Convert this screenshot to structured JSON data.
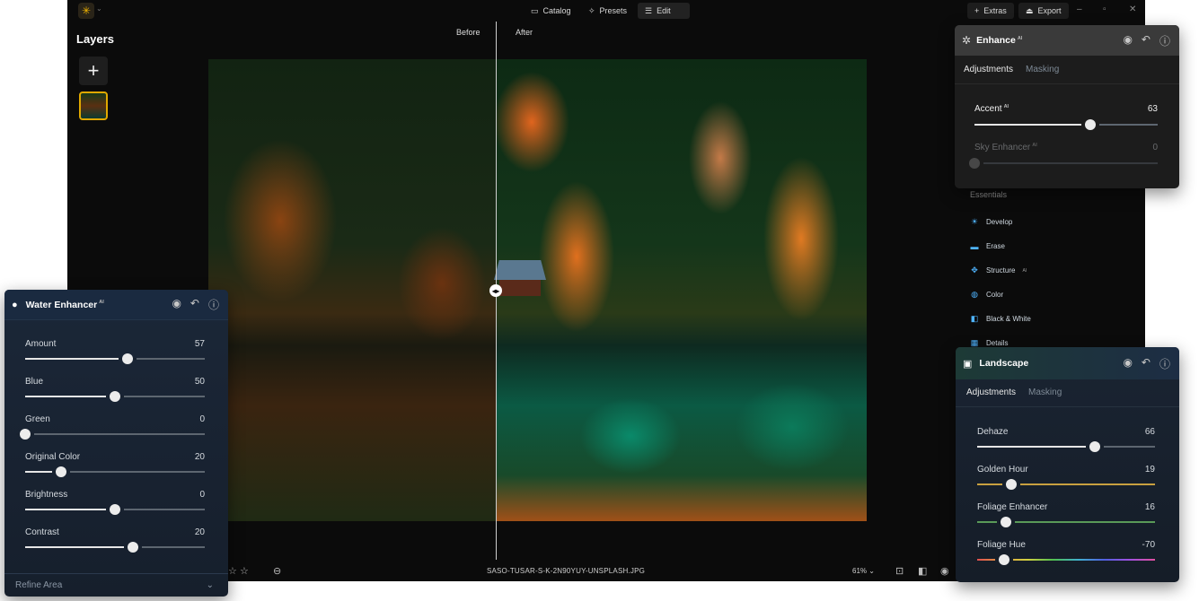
{
  "topbar": {
    "catalog": "Catalog",
    "presets": "Presets",
    "edit": "Edit",
    "extras": "Extras",
    "export": "Export"
  },
  "layers": {
    "title": "Layers"
  },
  "compare": {
    "before": "Before",
    "after": "After"
  },
  "enhance": {
    "title": "Enhance",
    "ai_badge": "AI",
    "tabs": [
      "Adjustments",
      "Masking"
    ],
    "sliders": [
      {
        "label": "Accent",
        "ai": "AI",
        "value": "63",
        "level": 0.63,
        "enabled": true
      },
      {
        "label": "Sky Enhancer",
        "ai": "AI",
        "value": "0",
        "level": 0,
        "enabled": false
      }
    ]
  },
  "essentials": {
    "heading": "Essentials",
    "items": [
      {
        "label": "Develop",
        "ai": ""
      },
      {
        "label": "Erase",
        "ai": ""
      },
      {
        "label": "Structure",
        "ai": "AI"
      },
      {
        "label": "Color",
        "ai": ""
      },
      {
        "label": "Black & White",
        "ai": ""
      },
      {
        "label": "Details",
        "ai": ""
      }
    ]
  },
  "water": {
    "title": "Water Enhancer",
    "ai_badge": "AI",
    "sliders": [
      {
        "label": "Amount",
        "value": "57",
        "level": 0.57
      },
      {
        "label": "Blue",
        "value": "50",
        "level": 0.5
      },
      {
        "label": "Green",
        "value": "0",
        "level": 0
      },
      {
        "label": "Original Color",
        "value": "20",
        "level": 0.2
      },
      {
        "label": "Brightness",
        "value": "0",
        "level": 0.5
      },
      {
        "label": "Contrast",
        "value": "20",
        "level": 0.6
      }
    ],
    "refine": "Refine Area"
  },
  "landscape": {
    "title": "Landscape",
    "tabs": [
      "Adjustments",
      "Masking"
    ],
    "sliders": [
      {
        "label": "Dehaze",
        "value": "66",
        "level": 0.66,
        "track": "#5d6670"
      },
      {
        "label": "Golden Hour",
        "value": "19",
        "level": 0.19,
        "track": "#c8a040"
      },
      {
        "label": "Foliage Enhancer",
        "value": "16",
        "level": 0.16,
        "track": "#5a9a58"
      },
      {
        "label": "Foliage Hue",
        "value": "-70",
        "level": 0.15,
        "track": "rainbow"
      }
    ]
  },
  "bottombar": {
    "filename": "SASO-TUSAR-S-K-2N90YUY-UNSPLASH.JPG",
    "zoom": "61%"
  },
  "colors": {
    "accent": "#e0a800",
    "link_icon": "#4fb4ff"
  }
}
